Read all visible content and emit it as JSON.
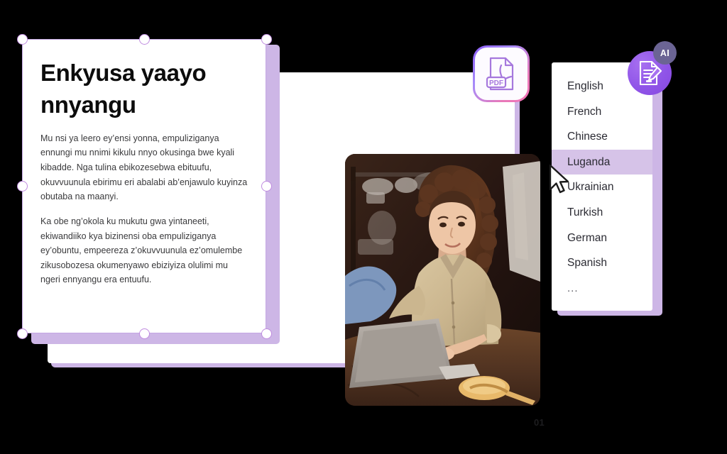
{
  "document_card": {
    "title": "Enkyusa yaayo nnyangu",
    "paragraphs": [
      "Mu nsi ya leero ey’ensi yonna, empuliziganya ennungi mu nnimi kikulu nnyo okusinga bwe kyali kibadde. Nga tulina ebikozesebwa ebituufu, okuvvuunula ebirimu eri abalabi ab’enjawulo kuyinza obutaba na maanyi.",
      "Ka obe ng’okola ku mukutu gwa yintaneeti, ekiwandiiko kya bizinensi oba empuliziganya ey’obuntu, empeereza z’okuvvuunula ez’omulembe zikusobozesa okumenyawo ebiziyiza olulimi mu ngeri ennyangu era entuufu."
    ]
  },
  "slide_card": {
    "page_number": "01",
    "photo_alt": "woman-with-curly-hair-working-on-laptop-at-wooden-table"
  },
  "pdf_chip": {
    "label": "PDF",
    "icon": "pdf-file-icon"
  },
  "language_list": {
    "selected": "Luganda",
    "items": [
      {
        "label": "English",
        "selected": false
      },
      {
        "label": "French",
        "selected": false
      },
      {
        "label": "Chinese",
        "selected": false
      },
      {
        "label": "Luganda",
        "selected": true
      },
      {
        "label": "Ukrainian",
        "selected": false
      },
      {
        "label": "Turkish",
        "selected": false
      },
      {
        "label": "German",
        "selected": false
      },
      {
        "label": "Spanish",
        "selected": false
      },
      {
        "label": "...",
        "selected": false
      }
    ]
  },
  "ai_badge": {
    "label": "AI",
    "icon": "document-edit-icon"
  },
  "cursor": {
    "icon": "mouse-pointer-icon"
  },
  "colors": {
    "accent_purple": "#8b5cf6",
    "shadow_purple": "#cdb6e6",
    "selection_purple": "#c08ce0",
    "highlight_row": "#d6c3e8",
    "pdf_outline": "#a678dd",
    "background": "#000000"
  }
}
